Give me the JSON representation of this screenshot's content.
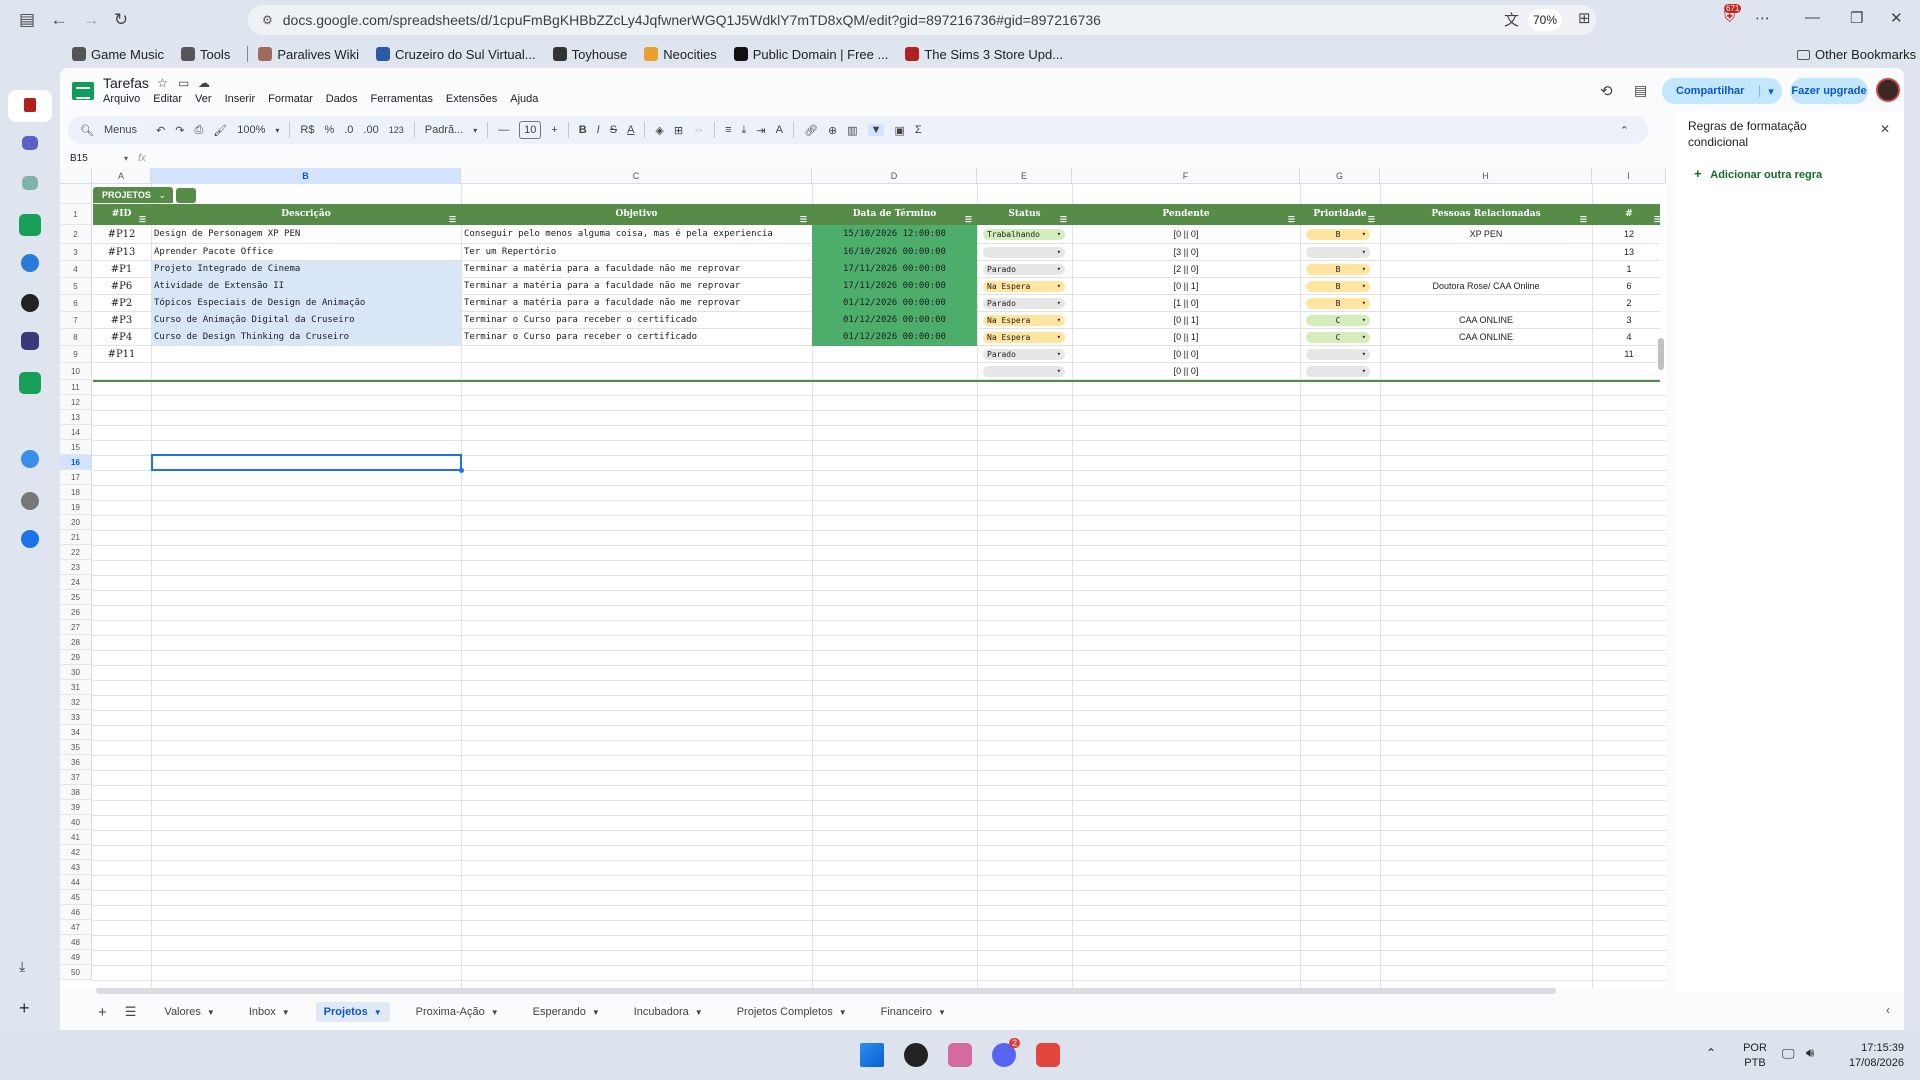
{
  "browser": {
    "url": "docs.google.com/spreadsheets/d/1cpuFmBgKHBbZZcLy4JqfwnerWGQ1J5WdklY7mTD8xQM/edit?gid=897216736#gid=897216736",
    "zoom": "70%",
    "badge_count": "671",
    "bookmarks": [
      {
        "label": "Game Music",
        "icon": "folder-icon",
        "color": "#555555"
      },
      {
        "label": "Tools",
        "icon": "folder-icon",
        "color": "#555555"
      },
      {
        "label": "Paralives Wiki",
        "icon": "paralives-icon",
        "color": "#a06a5a"
      },
      {
        "label": "Cruzeiro do Sul Virtual...",
        "icon": "cruzeiro-icon",
        "color": "#2a5aa8"
      },
      {
        "label": "Toyhouse",
        "icon": "toyhouse-icon",
        "color": "#333333"
      },
      {
        "label": "Neocities",
        "icon": "neocities-icon",
        "color": "#e8a030"
      },
      {
        "label": "Public Domain | Free ...",
        "icon": "public-domain-icon",
        "color": "#111111"
      },
      {
        "label": "The Sims 3 Store Upd...",
        "icon": "sims-icon",
        "color": "#b02020"
      }
    ],
    "other_bookmarks": "Other Bookmarks"
  },
  "doc": {
    "title": "Tarefas",
    "menus": [
      "Arquivo",
      "Editar",
      "Ver",
      "Inserir",
      "Formatar",
      "Dados",
      "Ferramentas",
      "Extensões",
      "Ajuda"
    ],
    "share_label": "Compartilhar",
    "upgrade_label": "Fazer upgrade"
  },
  "toolbar": {
    "search_label": "Menus",
    "zoom": "100%",
    "currency": "R$",
    "percent": "%",
    "dec_less": ".0",
    "dec_more": ".00",
    "number_format": "123",
    "font": "Padrã...",
    "font_size": "10"
  },
  "formula_bar": {
    "name_box": "B15",
    "fx": "fx"
  },
  "grid": {
    "columns": [
      "A",
      "B",
      "C",
      "D",
      "E",
      "F",
      "G",
      "H",
      "I"
    ],
    "selected_column": "B",
    "selected_row": "16",
    "table_name": "PROJETOS",
    "headers": [
      "#ID",
      "Descrição",
      "Objetivo",
      "Data de Término",
      "Status",
      "Pendente",
      "Prioridade",
      "Pessoas Relacionadas",
      "#"
    ],
    "rows": [
      {
        "id": "#P12",
        "desc": "Design de Personagem XP PEN",
        "obj": "Conseguir pelo menos alguma coisa, mas é pela experiencia",
        "date": "15/10/2026 12:00:00",
        "status": "Trabalhando",
        "pend": "[0 || 0]",
        "prio": "B",
        "people": "XP PEN",
        "num": "12",
        "blue": false
      },
      {
        "id": "#P13",
        "desc": "Aprender Pacote Office",
        "obj": "Ter um Repertório",
        "date": "16/10/2026 00:00:00",
        "status": "",
        "pend": "[3 || 0]",
        "prio": "",
        "people": "",
        "num": "13",
        "blue": false
      },
      {
        "id": "#P1",
        "desc": "Projeto Integrado de Cinema",
        "obj": "Terminar a matéria para a faculdade não me reprovar",
        "date": "17/11/2026 00:00:00",
        "status": "Parado",
        "pend": "[2 || 0]",
        "prio": "B",
        "people": "",
        "num": "1",
        "blue": true
      },
      {
        "id": "#P6",
        "desc": "Atividade de Extensão II",
        "obj": "Terminar a matéria para a faculdade não me reprovar",
        "date": "17/11/2026 00:00:00",
        "status": "Na Espera",
        "pend": "[0 || 1]",
        "prio": "B",
        "people": "Doutora Rose/ CAA Online",
        "num": "6",
        "blue": true
      },
      {
        "id": "#P2",
        "desc": "Tópicos Especiais de Design de Animação",
        "obj": "Terminar a matéria para a faculdade não me reprovar",
        "date": "01/12/2026 00:00:00",
        "status": "Parado",
        "pend": "[1 || 0]",
        "prio": "B",
        "people": "",
        "num": "2",
        "blue": true
      },
      {
        "id": "#P3",
        "desc": "Curso de Animação Digital da Cruseiro",
        "obj": "Terminar o Curso para receber o certificado",
        "date": "01/12/2026 00:00:00",
        "status": "Na Espera",
        "pend": "[0 || 1]",
        "prio": "C",
        "people": "CAA ONLINE",
        "num": "3",
        "blue": true
      },
      {
        "id": "#P4",
        "desc": "Curso de Design Thinking da Cruseiro",
        "obj": "Terminar o Curso para receber o certificado",
        "date": "01/12/2026 00:00:00",
        "status": "Na Espera",
        "pend": "[0 || 1]",
        "prio": "C",
        "people": "CAA ONLINE",
        "num": "4",
        "blue": true
      },
      {
        "id": "#P11",
        "desc": "",
        "obj": "",
        "date": "",
        "status": "Parado",
        "pend": "[0 || 0]",
        "prio": "",
        "people": "",
        "num": "11",
        "blue": false
      },
      {
        "id": "",
        "desc": "",
        "obj": "",
        "date": "",
        "status": "",
        "pend": "[0 || 0]",
        "prio": "",
        "people": "",
        "num": "",
        "blue": false
      }
    ],
    "status_colors": {
      "Trabalhando": "#d4edbc",
      "Parado": "#e6e6e6",
      "Na Espera": "#ffe5a0",
      "": "#e6e6e6"
    },
    "prio_colors": {
      "B": "#ffe5a0",
      "C": "#d4edbc",
      "": "#e6e6e6"
    },
    "header_color": "#568c48",
    "date_color": "#4cae6a",
    "last_row": 50
  },
  "sheet_tabs": [
    {
      "label": "Valores",
      "active": false
    },
    {
      "label": "Inbox",
      "active": false
    },
    {
      "label": "Projetos",
      "active": true
    },
    {
      "label": "Proxima-Ação",
      "active": false
    },
    {
      "label": "Esperando",
      "active": false
    },
    {
      "label": "Incubadora",
      "active": false
    },
    {
      "label": "Projetos Completos",
      "active": false
    },
    {
      "label": "Financeiro",
      "active": false
    }
  ],
  "side_panel": {
    "title": "Regras de formatação condicional",
    "add_rule": "Adicionar outra regra"
  },
  "taskbar": {
    "lang_1": "POR",
    "lang_2": "PTB",
    "time": "17:15:39",
    "date": "17/08/2026",
    "discord_badge": "2"
  }
}
